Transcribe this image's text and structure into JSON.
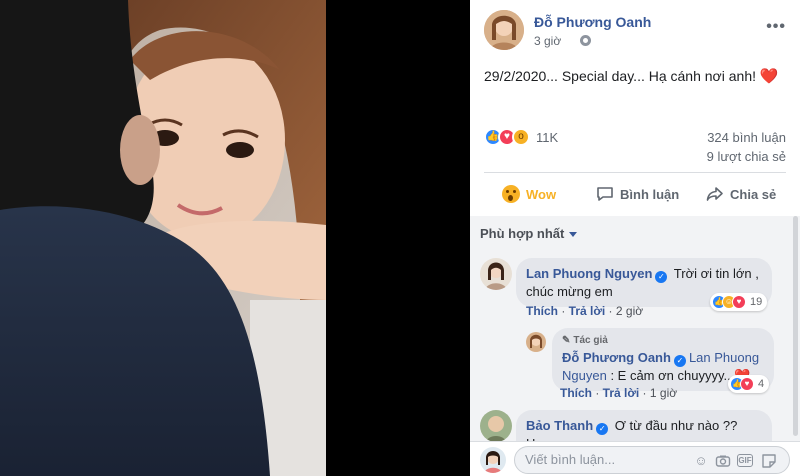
{
  "post": {
    "author": "Đỗ Phương Oanh",
    "time": "3 giờ",
    "text": "29/2/2020... Special day... Hạ cánh nơi anh!",
    "text_emoji": "❤️",
    "reaction_total": "11K",
    "comment_count": "324 bình luận",
    "share_count": "9 lượt chia sẻ"
  },
  "actions": {
    "wow": "Wow",
    "comment": "Bình luận",
    "share": "Chia sẻ"
  },
  "comments": {
    "sort_label": "Phù hợp nhất",
    "c1": {
      "name": "Lan Phuong Nguyen",
      "text": "Trời ơi tin lớn , chúc mừng em",
      "like": "Thích",
      "reply": "Trả lời",
      "time": "2 giờ",
      "reactions": "19"
    },
    "r1": {
      "author_tag": "Tác giả",
      "name": "Đỗ Phương Oanh",
      "mention": "Lan Phuong Nguyen",
      "text": ": E cảm ơn chuyyyy...",
      "like": "Thích",
      "reply": "Trả lời",
      "time": "1 giờ",
      "reactions": "4"
    },
    "c2": {
      "name": "Bảo Thanh",
      "text": "Ơ từ đầu như nào ?? Hoang"
    }
  },
  "composer": {
    "placeholder": "Viết bình luận..."
  },
  "colors": {
    "link": "#385898",
    "like": "#2d88ff",
    "love": "#f33e58",
    "wow": "#f7b125"
  }
}
